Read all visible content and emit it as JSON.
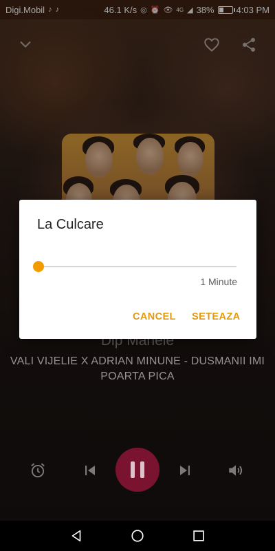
{
  "status_bar": {
    "carrier": "Digi.Mobil",
    "net_speed": "46.1 K/s",
    "battery_percent": "38%",
    "battery_level": 0.38,
    "time": "4:03 PM",
    "signal_badge": "4G"
  },
  "player": {
    "station_name": "Dip Manele",
    "track_title": "VALI VIJELIE X ADRIAN MINUNE - DUSMANII IMI POARTA PICA"
  },
  "dialog": {
    "title": "La Culcare",
    "slider_value_label": "1 Minute",
    "slider_level": 0,
    "cancel_label": "CANCEL",
    "confirm_label": "SETEAZA"
  },
  "colors": {
    "accent": "#f29a00",
    "button_text": "#e09a10",
    "play_button": "#7a1330"
  },
  "icons": {
    "collapse": "chevron-down-icon",
    "favorite": "heart-outline-icon",
    "share": "share-icon",
    "alarm": "alarm-clock-icon",
    "previous": "skip-previous-icon",
    "pause": "pause-icon",
    "next": "skip-next-icon",
    "volume": "volume-icon",
    "nav_back": "triangle-back-icon",
    "nav_home": "circle-home-icon",
    "nav_recents": "square-recents-icon"
  }
}
